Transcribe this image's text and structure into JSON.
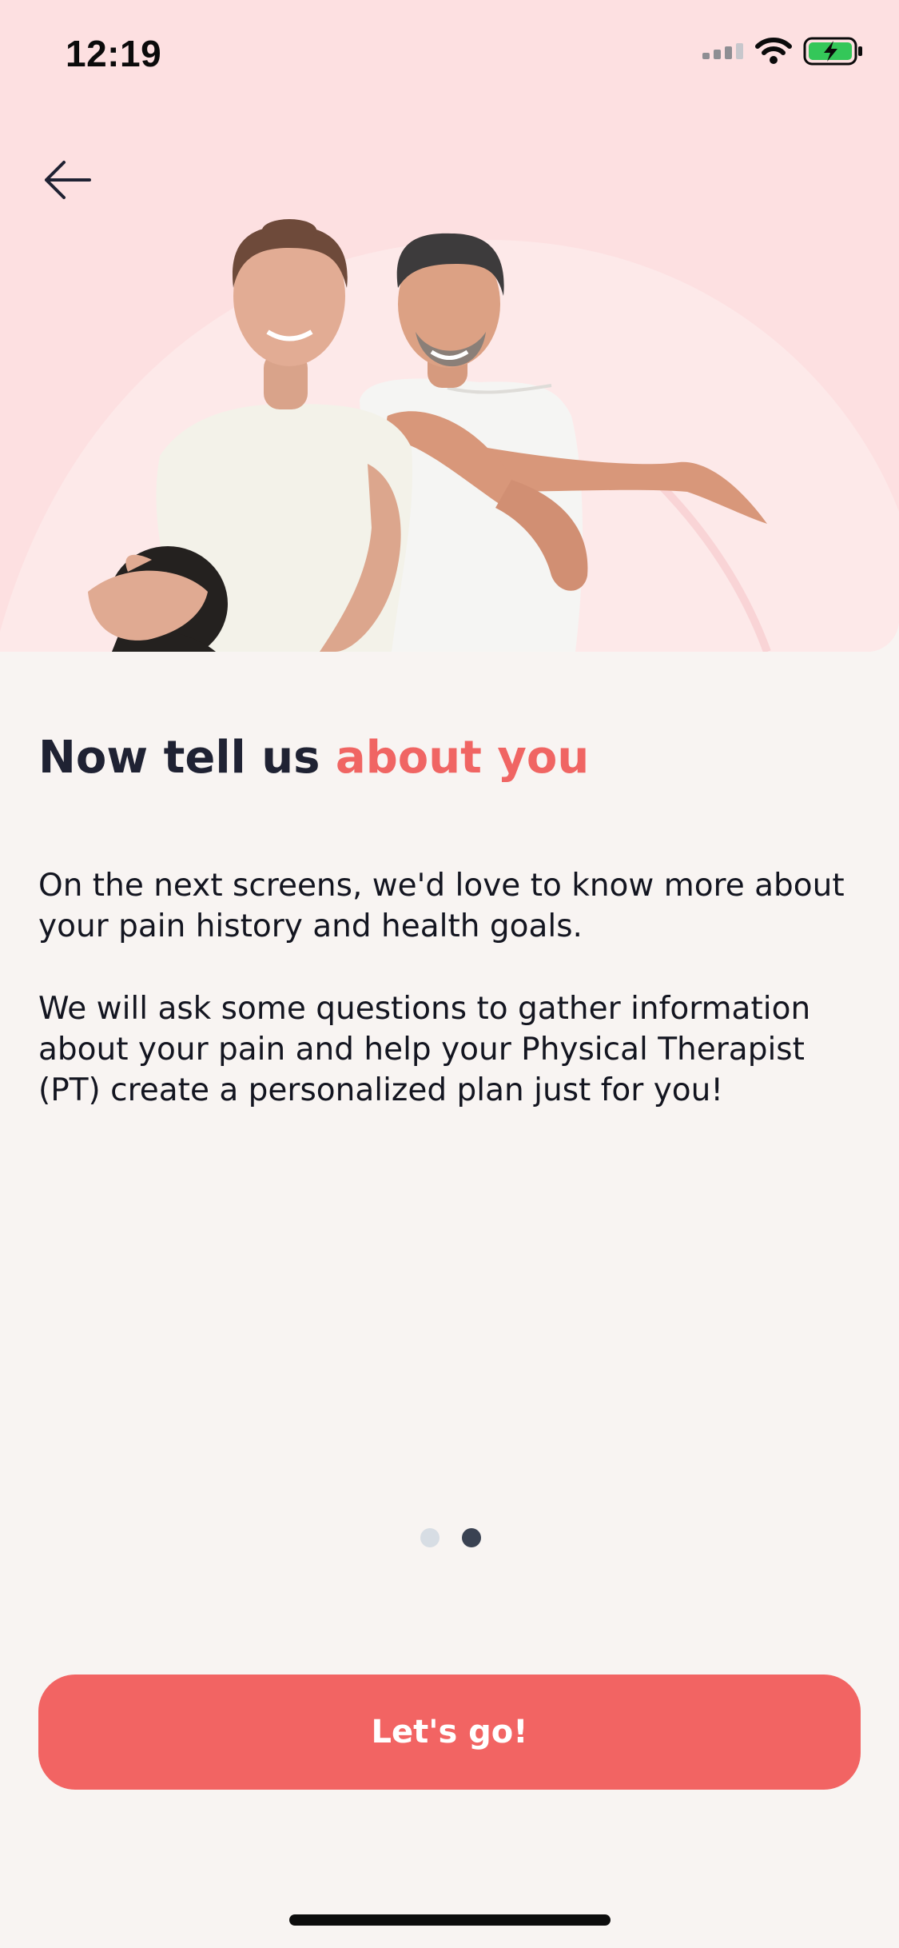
{
  "status_bar": {
    "time": "12:19"
  },
  "navigation": {
    "back_icon": "arrow-left-icon"
  },
  "hero": {
    "image": "woman-and-man-stretching-photo"
  },
  "content": {
    "title_part1": "Now tell us ",
    "title_part2": "about you",
    "paragraph1": "On the next screens, we'd love to know more about your pain history and health goals.",
    "paragraph2": "We will ask some questions to gather information about your pain and help your Physical Therapist (PT) create a personalized plan just for you!"
  },
  "pager": {
    "total": 2,
    "current": 2
  },
  "cta": {
    "label": "Let's go!"
  },
  "colors": {
    "accent": "#f26463",
    "hero_background": "#fde0e1",
    "page_background": "#f8f4f2",
    "title": "#1f2233"
  }
}
